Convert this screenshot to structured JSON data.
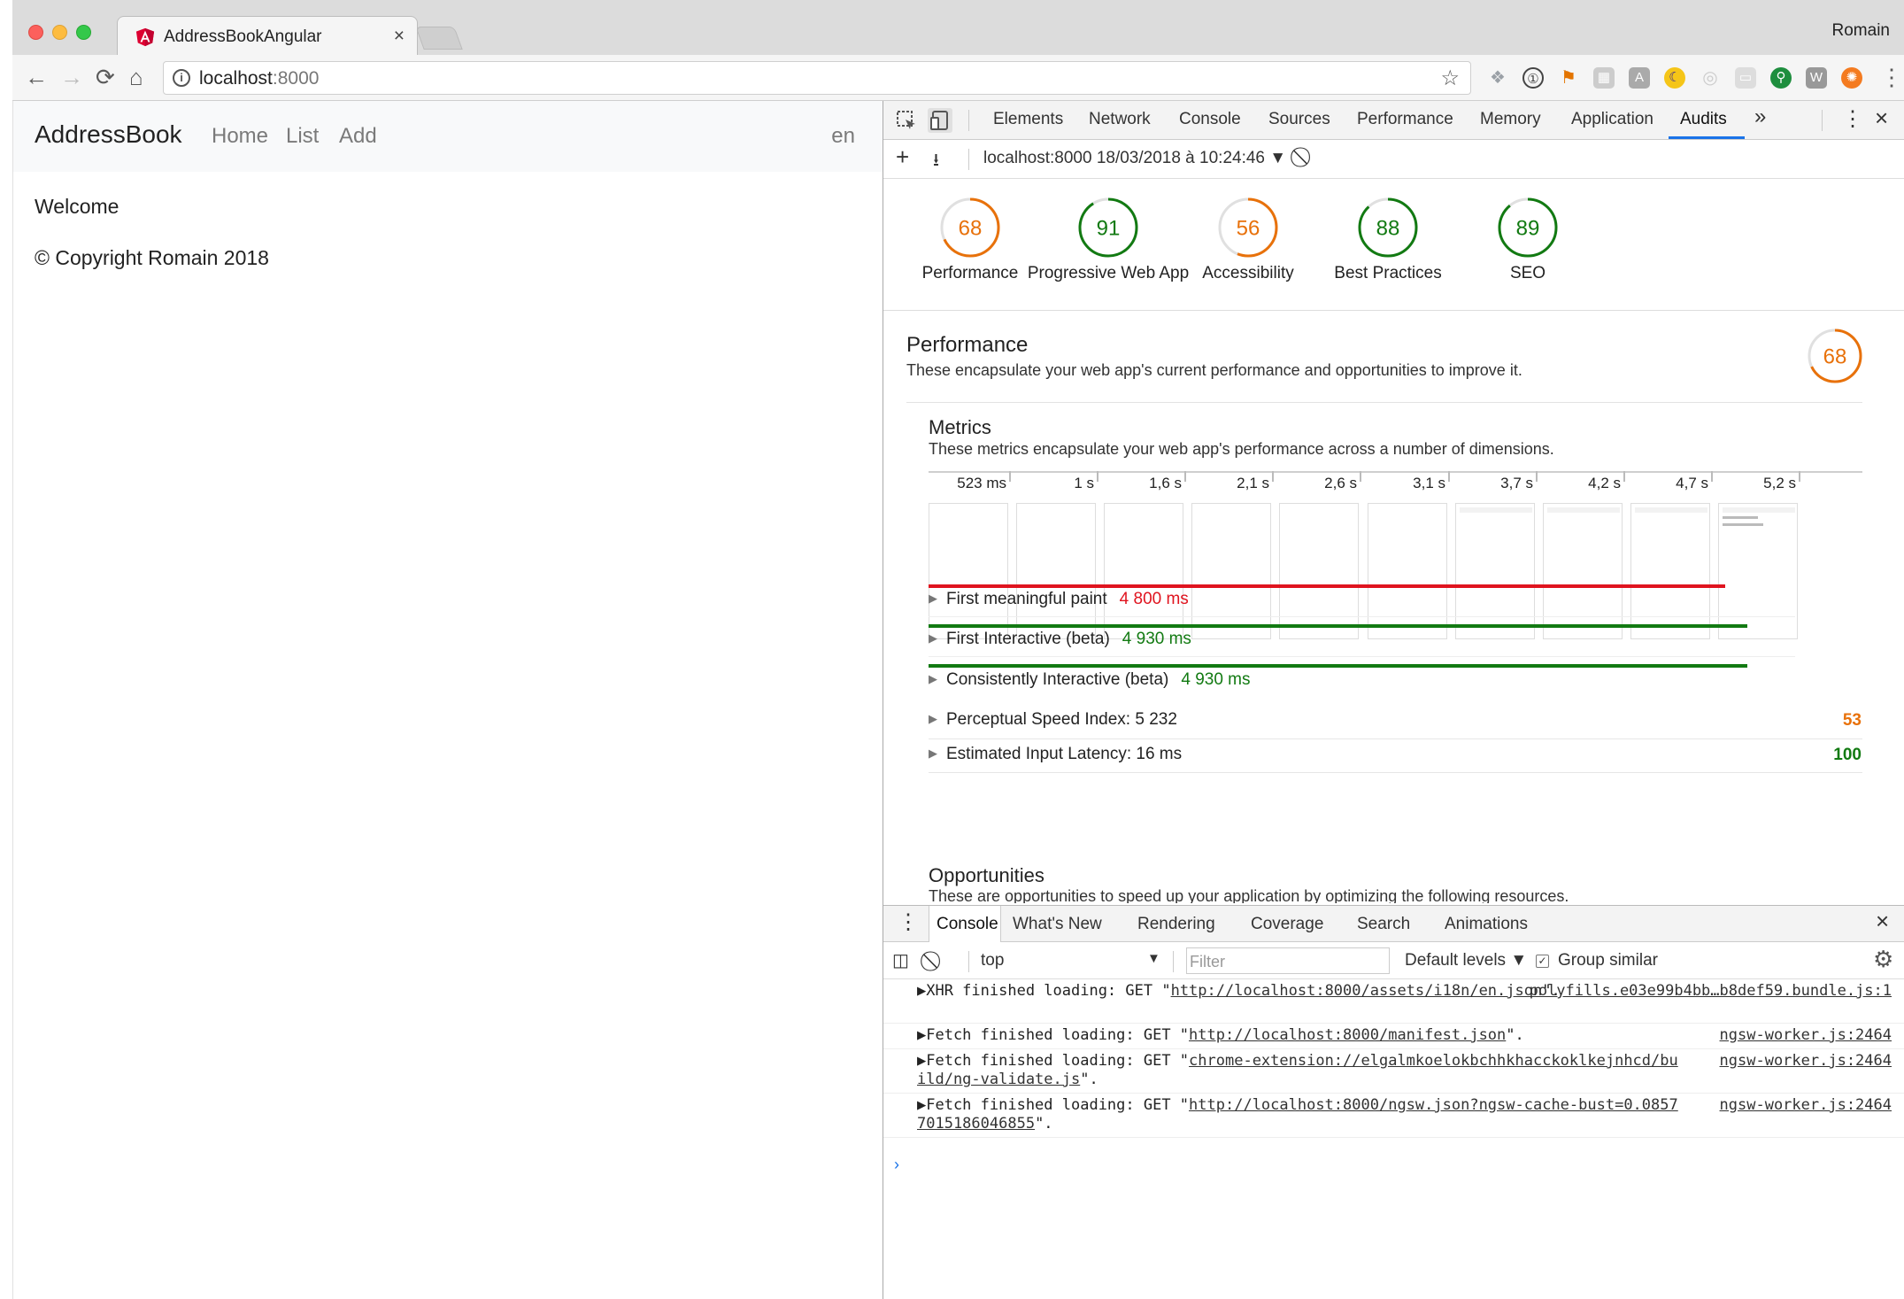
{
  "browser": {
    "tab_title": "AddressBookAngular",
    "tab_close": "×",
    "profile": "Romain",
    "url_host": "localhost",
    "url_port": ":8000"
  },
  "page": {
    "brand": "AddressBook",
    "nav": [
      "Home",
      "List",
      "Add"
    ],
    "lang": "en",
    "welcome": "Welcome",
    "copyright": "© Copyright Romain 2018"
  },
  "devtools": {
    "tabs": [
      "Elements",
      "Network",
      "Console",
      "Sources",
      "Performance",
      "Memory",
      "Application",
      "Audits"
    ],
    "active_tab": "Audits",
    "more": "»",
    "audit_run": "localhost:8000 18/03/2018 à 10:24:46",
    "scores": [
      {
        "label": "Performance",
        "value": 68,
        "color": "#e8710a"
      },
      {
        "label": "Progressive Web App",
        "value": 91,
        "color": "#127a12"
      },
      {
        "label": "Accessibility",
        "value": 56,
        "color": "#e8710a"
      },
      {
        "label": "Best Practices",
        "value": 88,
        "color": "#127a12"
      },
      {
        "label": "SEO",
        "value": 89,
        "color": "#127a12"
      }
    ],
    "performance": {
      "title": "Performance",
      "description": "These encapsulate your web app's current performance and opportunities to improve it.",
      "score": 68
    },
    "metrics": {
      "title": "Metrics",
      "description": "These metrics encapsulate your web app's performance across a number of dimensions.",
      "filmstrip_times": [
        "523 ms",
        "1 s",
        "1,6 s",
        "2,1 s",
        "2,6 s",
        "3,1 s",
        "3,7 s",
        "4,2 s",
        "4,7 s",
        "5,2 s"
      ],
      "rows": [
        {
          "label": "First meaningful paint",
          "value": "4 800 ms",
          "status": "red"
        },
        {
          "label": "First Interactive (beta)",
          "value": "4 930 ms",
          "status": "green"
        },
        {
          "label": "Consistently Interactive (beta)",
          "value": "4 930 ms",
          "status": "green"
        }
      ],
      "scored_rows": [
        {
          "label": "Perceptual Speed Index: 5 232",
          "score": "53",
          "status": "orange"
        },
        {
          "label": "Estimated Input Latency: 16 ms",
          "score": "100",
          "status": "green"
        }
      ]
    },
    "opportunities": {
      "title": "Opportunities",
      "description": "These are opportunities to speed up your application by optimizing the following resources."
    },
    "drawer": {
      "tabs": [
        "Console",
        "What's New",
        "Rendering",
        "Coverage",
        "Search",
        "Animations"
      ],
      "context": "top",
      "filter_placeholder": "Filter",
      "levels": "Default levels ▼",
      "group_similar": "Group similar",
      "logs": [
        {
          "prefix": "▶XHR finished loading: GET \"",
          "link": "http://localhost:8000/assets/i18n/en.json",
          "suffix": "\".",
          "source": "polyfills.e03e99b4bb…b8def59.bundle.js:1"
        },
        {
          "prefix": "▶Fetch finished loading: GET \"",
          "link": "http://localhost:8000/manifest.json",
          "suffix": "\".",
          "source": "ngsw-worker.js:2464"
        },
        {
          "prefix": "▶Fetch finished loading: GET \"",
          "link": "chrome-extension://elgalmkoelokbchhkhacckoklkejnhcd/build/ng-validate.js",
          "suffix": "\".",
          "source": "ngsw-worker.js:2464"
        },
        {
          "prefix": "▶Fetch finished loading: GET \"",
          "link": "http://localhost:8000/ngsw.json?ngsw-cache-bust=0.08577015186046855",
          "suffix": "\".",
          "source": "ngsw-worker.js:2464"
        }
      ],
      "prompt": "›"
    }
  }
}
